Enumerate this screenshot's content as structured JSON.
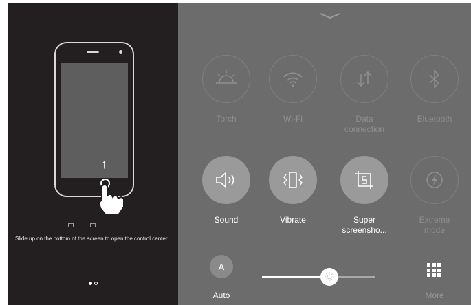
{
  "tutorial": {
    "instruction": "Slide up on the bottom of the screen to open the control center",
    "page_indicator": {
      "total": 2,
      "active": 1
    }
  },
  "control_center": {
    "row1": [
      {
        "label": "Torch",
        "icon": "torch-icon",
        "active": false
      },
      {
        "label": "Wi-Fi",
        "icon": "wifi-icon",
        "active": false
      },
      {
        "label": "Data\nconnection",
        "icon": "data-connection-icon",
        "active": false
      },
      {
        "label": "Bluetooth",
        "icon": "bluetooth-icon",
        "active": false
      }
    ],
    "row2": [
      {
        "label": "Sound",
        "icon": "sound-icon",
        "active": true
      },
      {
        "label": "Vibrate",
        "icon": "vibrate-icon",
        "active": true
      },
      {
        "label": "Super\nscreensho...",
        "icon": "screenshot-icon",
        "active": true
      },
      {
        "label": "Extreme\nmode",
        "icon": "extreme-mode-icon",
        "active": false
      }
    ],
    "brightness": {
      "auto_symbol": "A",
      "auto_label": "Auto",
      "level": 0.58
    },
    "more_label": "More"
  },
  "colors": {
    "tutorial_bg": "#231f20",
    "panel_bg": "#6c6c6c",
    "active_circle": "#9a9a9a",
    "dim_text": "#8e8e8e"
  }
}
